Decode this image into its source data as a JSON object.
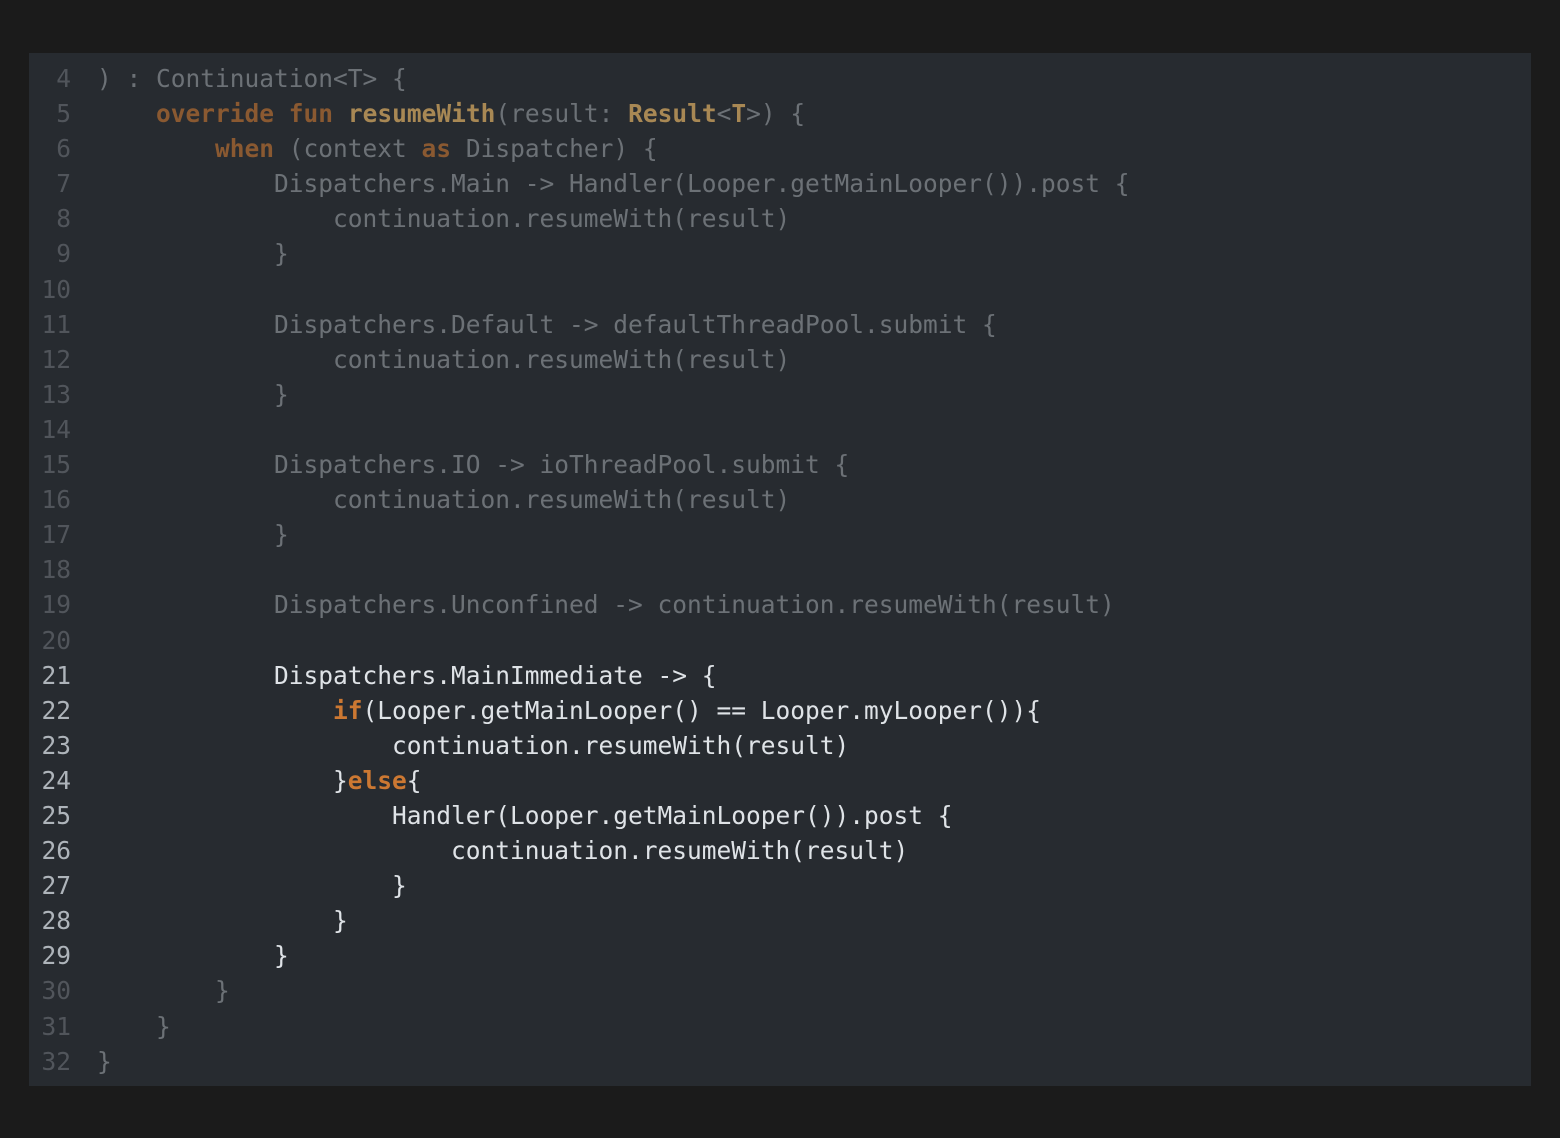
{
  "editor": {
    "lines": [
      {
        "num": "4",
        "dim": true,
        "tokens": [
          {
            "t": ") : Continuation<T> {",
            "c": ""
          }
        ]
      },
      {
        "num": "5",
        "dim": true,
        "tokens": [
          {
            "t": "    ",
            "c": ""
          },
          {
            "t": "override",
            "c": "kw"
          },
          {
            "t": " ",
            "c": ""
          },
          {
            "t": "fun",
            "c": "kw"
          },
          {
            "t": " ",
            "c": ""
          },
          {
            "t": "resumeWith",
            "c": "fn"
          },
          {
            "t": "(result: ",
            "c": ""
          },
          {
            "t": "Result",
            "c": "ty"
          },
          {
            "t": "<",
            "c": ""
          },
          {
            "t": "T",
            "c": "ty"
          },
          {
            "t": ">) {",
            "c": ""
          }
        ]
      },
      {
        "num": "6",
        "dim": true,
        "tokens": [
          {
            "t": "        ",
            "c": ""
          },
          {
            "t": "when",
            "c": "kw"
          },
          {
            "t": " (context ",
            "c": ""
          },
          {
            "t": "as",
            "c": "kw"
          },
          {
            "t": " Dispatcher) {",
            "c": ""
          }
        ]
      },
      {
        "num": "7",
        "dim": true,
        "tokens": [
          {
            "t": "            Dispatchers.Main -> Handler(Looper.getMainLooper()).post {",
            "c": ""
          }
        ]
      },
      {
        "num": "8",
        "dim": true,
        "tokens": [
          {
            "t": "                continuation.resumeWith(result)",
            "c": ""
          }
        ]
      },
      {
        "num": "9",
        "dim": true,
        "tokens": [
          {
            "t": "            }",
            "c": ""
          }
        ]
      },
      {
        "num": "10",
        "dim": true,
        "tokens": [
          {
            "t": "",
            "c": ""
          }
        ]
      },
      {
        "num": "11",
        "dim": true,
        "tokens": [
          {
            "t": "            Dispatchers.Default -> defaultThreadPool.submit {",
            "c": ""
          }
        ]
      },
      {
        "num": "12",
        "dim": true,
        "tokens": [
          {
            "t": "                continuation.resumeWith(result)",
            "c": ""
          }
        ]
      },
      {
        "num": "13",
        "dim": true,
        "tokens": [
          {
            "t": "            }",
            "c": ""
          }
        ]
      },
      {
        "num": "14",
        "dim": true,
        "tokens": [
          {
            "t": "",
            "c": ""
          }
        ]
      },
      {
        "num": "15",
        "dim": true,
        "tokens": [
          {
            "t": "            Dispatchers.IO -> ioThreadPool.submit {",
            "c": ""
          }
        ]
      },
      {
        "num": "16",
        "dim": true,
        "tokens": [
          {
            "t": "                continuation.resumeWith(result)",
            "c": ""
          }
        ]
      },
      {
        "num": "17",
        "dim": true,
        "tokens": [
          {
            "t": "            }",
            "c": ""
          }
        ]
      },
      {
        "num": "18",
        "dim": true,
        "tokens": [
          {
            "t": "",
            "c": ""
          }
        ]
      },
      {
        "num": "19",
        "dim": true,
        "tokens": [
          {
            "t": "            Dispatchers.Unconfined -> continuation.resumeWith(result)",
            "c": ""
          }
        ]
      },
      {
        "num": "20",
        "dim": true,
        "tokens": [
          {
            "t": "",
            "c": ""
          }
        ]
      },
      {
        "num": "21",
        "dim": false,
        "tokens": [
          {
            "t": "            Dispatchers.MainImmediate -> {",
            "c": ""
          }
        ]
      },
      {
        "num": "22",
        "dim": false,
        "tokens": [
          {
            "t": "                ",
            "c": ""
          },
          {
            "t": "if",
            "c": "kw"
          },
          {
            "t": "(Looper.getMainLooper() == Looper.myLooper()){",
            "c": ""
          }
        ]
      },
      {
        "num": "23",
        "dim": false,
        "tokens": [
          {
            "t": "                    continuation.resumeWith(result)",
            "c": ""
          }
        ]
      },
      {
        "num": "24",
        "dim": false,
        "tokens": [
          {
            "t": "                }",
            "c": ""
          },
          {
            "t": "else",
            "c": "kw"
          },
          {
            "t": "{",
            "c": ""
          }
        ]
      },
      {
        "num": "25",
        "dim": false,
        "tokens": [
          {
            "t": "                    Handler(Looper.getMainLooper()).post {",
            "c": ""
          }
        ]
      },
      {
        "num": "26",
        "dim": false,
        "tokens": [
          {
            "t": "                        continuation.resumeWith(result)",
            "c": ""
          }
        ]
      },
      {
        "num": "27",
        "dim": false,
        "tokens": [
          {
            "t": "                    }",
            "c": ""
          }
        ]
      },
      {
        "num": "28",
        "dim": false,
        "tokens": [
          {
            "t": "                }",
            "c": ""
          }
        ]
      },
      {
        "num": "29",
        "dim": false,
        "tokens": [
          {
            "t": "            }",
            "c": ""
          }
        ]
      },
      {
        "num": "30",
        "dim": true,
        "tokens": [
          {
            "t": "        }",
            "c": ""
          }
        ]
      },
      {
        "num": "31",
        "dim": true,
        "tokens": [
          {
            "t": "    }",
            "c": ""
          }
        ]
      },
      {
        "num": "32",
        "dim": true,
        "tokens": [
          {
            "t": "}",
            "c": ""
          }
        ]
      }
    ]
  }
}
